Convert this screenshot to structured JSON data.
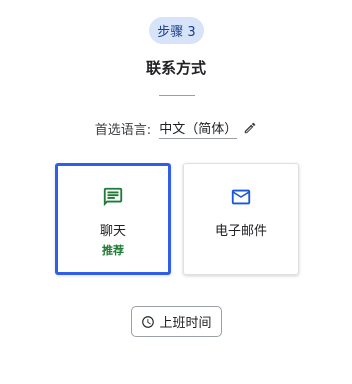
{
  "step_badge": "步骤 3",
  "title": "联系方式",
  "language": {
    "label": "首选语言:",
    "value": "中文（简体）"
  },
  "options": [
    {
      "label": "聊天",
      "sublabel": "推荐",
      "icon": "chat-icon",
      "selected": true
    },
    {
      "label": "电子邮件",
      "icon": "mail-icon",
      "selected": false
    }
  ],
  "hours_button": {
    "label": "上班时间",
    "icon": "clock-icon"
  },
  "colors": {
    "accent": "#2f5ee8",
    "badge_bg": "#d7e3f8",
    "chat_icon": "#1e7a35",
    "mail_icon": "#1a56db",
    "recommended": "#1e7a35"
  }
}
